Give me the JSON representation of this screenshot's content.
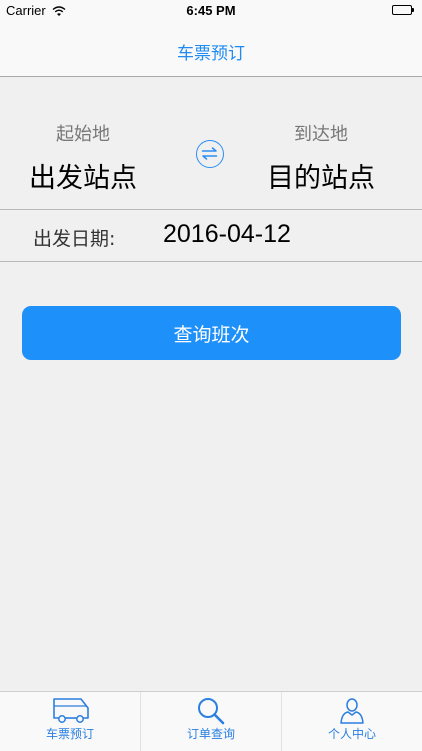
{
  "status_bar": {
    "carrier": "Carrier",
    "time": "6:45 PM",
    "battery_level": 1.0
  },
  "nav": {
    "title": "车票预订"
  },
  "route": {
    "origin_label": "起始地",
    "origin_value": "出发站点",
    "destination_label": "到达地",
    "destination_value": "目的站点",
    "swap_icon": "swap-arrows-icon"
  },
  "date": {
    "label": "出发日期:",
    "value": "2016-04-12"
  },
  "search_button": {
    "label": "查询班次"
  },
  "tab_bar": {
    "tabs": [
      {
        "label": "车票预订",
        "icon": "bus-icon"
      },
      {
        "label": "订单查询",
        "icon": "search-icon"
      },
      {
        "label": "个人中心",
        "icon": "person-icon"
      }
    ]
  },
  "colors": {
    "accent": "#1e90fa",
    "background": "#f0f0f0",
    "bar_background": "#f9f9f9"
  }
}
